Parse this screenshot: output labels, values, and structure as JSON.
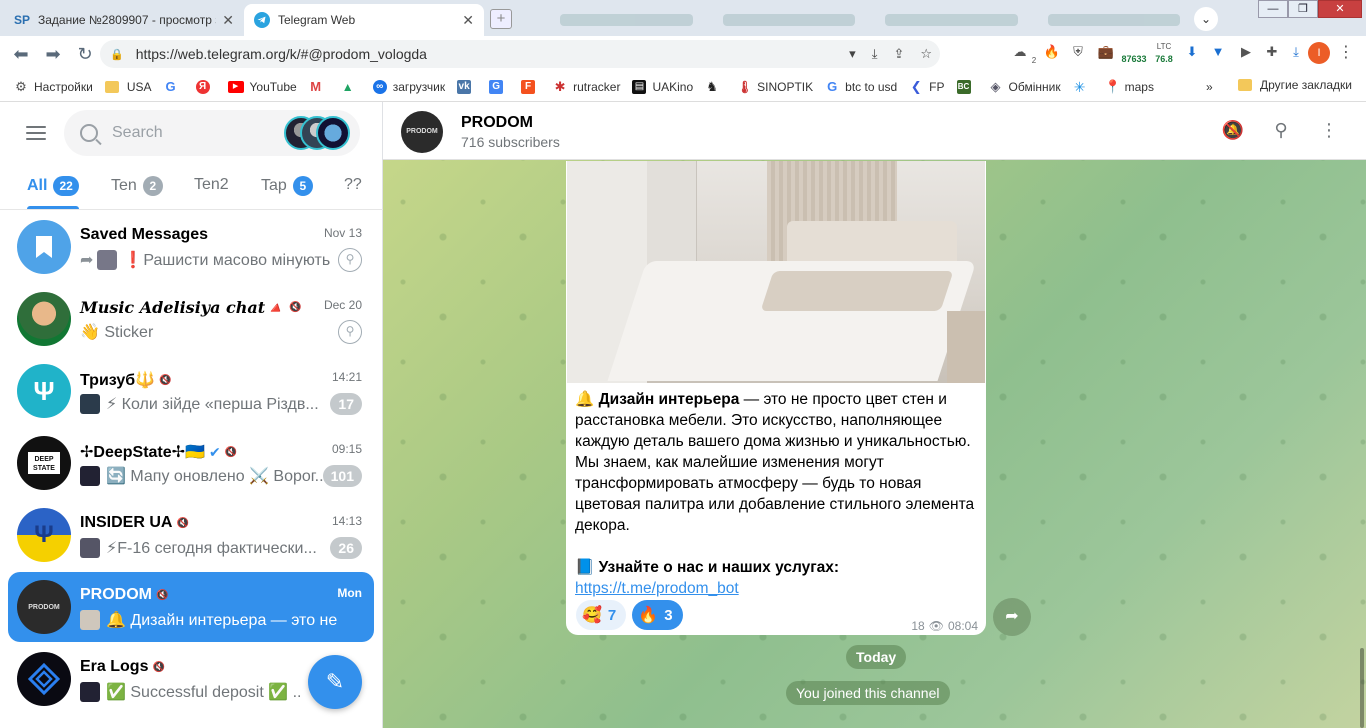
{
  "browser": {
    "tabs": [
      {
        "label": "Задание №2809907 - просмотр з",
        "icon": "SP"
      },
      {
        "label": "Telegram Web",
        "icon": "telegram-icon"
      }
    ],
    "url": "https://web.telegram.org/k/#@prodom_vologda",
    "ext_values": {
      "btc": "87633",
      "ltc_label": "LTC",
      "ltc": "76.8",
      "notif": "2"
    },
    "profile_initial": "I",
    "bookmarks": [
      "Настройки",
      "USA",
      "",
      "",
      "YouTube",
      "",
      "",
      "загрузчик",
      "",
      "",
      "",
      "rutracker",
      "UAKino",
      "",
      "SINOPTIK",
      "btc to usd",
      "FP",
      "",
      "Обмінник",
      "",
      "maps"
    ],
    "bookmarks_more": "»",
    "bookmarks_other": "Другие закладки"
  },
  "sidebar": {
    "search_placeholder": "Search",
    "folders": [
      {
        "label": "All",
        "count": "22"
      },
      {
        "label": "Ten",
        "count": "2"
      },
      {
        "label": "Ten2",
        "count": ""
      },
      {
        "label": "Tap",
        "count": "5"
      },
      {
        "label": "??",
        "count": ""
      }
    ],
    "chats": [
      {
        "name": "Saved Messages",
        "time": "Nov 13",
        "preview": "❗Рашисти масово мінують...",
        "pinned": true,
        "unread": ""
      },
      {
        "name": "𝑴𝒖𝒔𝒊𝒄 𝑨𝒅𝒆𝒍𝒊𝒔𝒊𝒚𝒂 𝒄𝒉𝒂𝒕🔺",
        "time": "Dec 20",
        "preview": "👋 Sticker",
        "pinned": true,
        "unread": ""
      },
      {
        "name": "Тризуб🔱",
        "time": "14:21",
        "preview": "⚡ Коли зійде «перша Різдв...",
        "pinned": false,
        "unread": "17"
      },
      {
        "name": "✢DeepState✢🇺🇦",
        "time": "09:15",
        "preview": "🔄 Мапу оновлено ⚔️ Ворог...",
        "pinned": false,
        "unread": "101"
      },
      {
        "name": "INSIDER UA",
        "time": "14:13",
        "preview": "⚡F-16 сегодня фактически...",
        "pinned": false,
        "unread": "26"
      },
      {
        "name": "PRODOM",
        "time": "Mon",
        "preview": "🔔 Дизайн интерьера — это не п...",
        "pinned": false,
        "unread": ""
      },
      {
        "name": "Era Logs",
        "time": "",
        "preview": "✅ Successful deposit ✅ ...",
        "pinned": false,
        "unread": ""
      }
    ]
  },
  "channel": {
    "title": "PRODOM",
    "subtitle": "716 subscribers",
    "avatar_text": "PRODOM",
    "message": {
      "bold_lead": "Дизайн интерьера",
      "body": " — это не просто цвет стен и расстановка мебели. Это искусство, наполняющее каждую деталь вашего дома жизнью и уникальностью. Мы знаем, как малейшие изменения могут трансформировать атмосферу — будь то новая цветовая палитра или добавление стильного элемента декора.",
      "cta": "Узнайте о нас и наших услугах:",
      "link": "https://t.me/prodom_bot",
      "reactions": [
        {
          "emoji": "🥰",
          "count": "7",
          "chosen": false
        },
        {
          "emoji": "🔥",
          "count": "3",
          "chosen": true
        }
      ],
      "views": "18",
      "time": "08:04"
    },
    "service_today": "Today",
    "service_joined": "You joined this channel"
  },
  "colors": {
    "accent": "#3390ec",
    "tabbar": "#dfe6ee",
    "badge_muted": "#c4c9cc"
  }
}
